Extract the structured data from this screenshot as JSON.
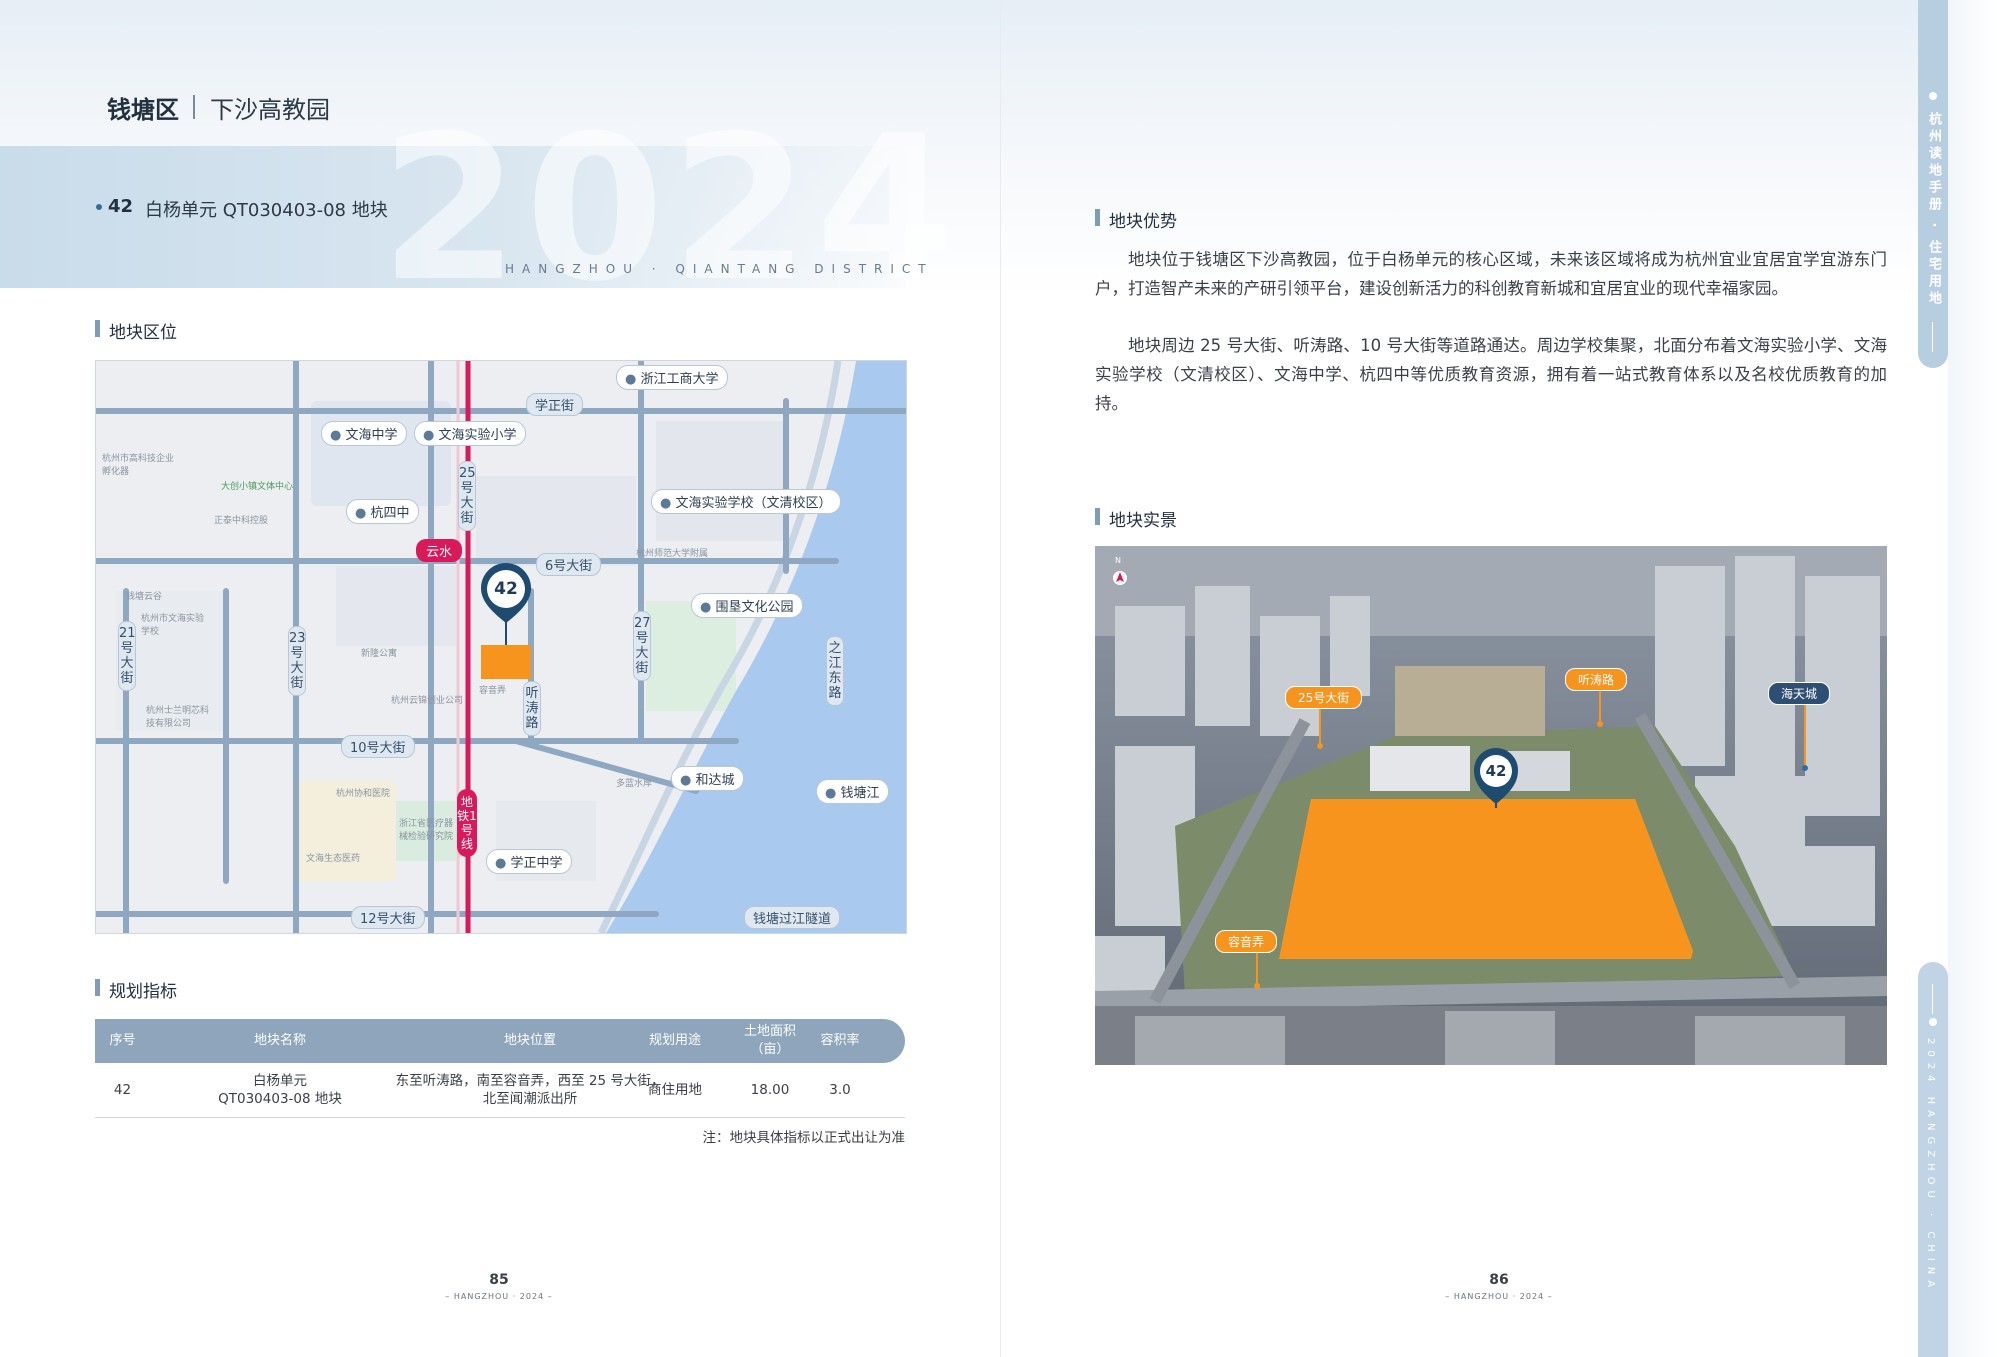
{
  "left_page": {
    "district": "钱塘区",
    "sub_district": "下沙高教园",
    "big_year": "2024",
    "district_en": "HANGZHOU · QIANTANG DISTRICT",
    "plot_number": "42",
    "plot_name": "白杨单元 QT030403-08 地块",
    "location_title": "地块区位",
    "plan_title": "规划指标",
    "page_number": "85",
    "page_footer": "– HANGZHOU · 2024 –"
  },
  "map": {
    "marker": "42",
    "road_labels": [
      "学正街",
      "6号大街",
      "10号大街",
      "12号大街",
      "21号大街",
      "23号大街",
      "25号大街",
      "27号大街",
      "听涛路",
      "之江东路",
      "钱塘过江隧道"
    ],
    "pois": [
      {
        "type": "学",
        "name": "浙江工商大学"
      },
      {
        "type": "学",
        "name": "文海中学"
      },
      {
        "type": "学",
        "name": "文海实验小学"
      },
      {
        "type": "学",
        "name": "文海实验学校（文清校区）"
      },
      {
        "type": "学",
        "name": "杭四中"
      },
      {
        "type": "学",
        "name": "学正中学"
      },
      {
        "type": "文",
        "name": "围垦文化公园"
      },
      {
        "type": "商",
        "name": "和达城"
      },
      {
        "type": "景",
        "name": "钱塘江"
      }
    ],
    "metro_station": "云水",
    "metro_line": "地铁1号线",
    "minor_labels": [
      "杭州市高科技企业孵化器",
      "大创小镇文体中心",
      "正泰中科控股",
      "杭州云锦创业公司",
      "新隆公寓",
      "杭州师范大学附属",
      "多蓝水岸",
      "容音弄",
      "钱塘云谷",
      "杭州市文海实验学校",
      "浙江省医疗器械检验研究院",
      "杭州协和医院",
      "文海生态医药",
      "杭州士兰明芯科技有限公司"
    ]
  },
  "plan_table": {
    "headers": [
      "序号",
      "地块名称",
      "地块位置",
      "规划用途",
      "土地面积\n（亩）",
      "容积率"
    ],
    "rows": [
      [
        "42",
        "白杨单元\nQT030403-08 地块",
        "东至听涛路，南至容音弄，西至 25 号大街，\n北至闻潮派出所",
        "商住用地",
        "18.00",
        "3.0"
      ]
    ],
    "note": "注：地块具体指标以正式出让为准"
  },
  "right_page": {
    "advantage_title": "地块优势",
    "para1": "地块位于钱塘区下沙高教园，位于白杨单元的核心区域，未来该区域将成为杭州宜业宜居宜学宜游东门户，打造智产未来的产研引领平台，建设创新活力的科创教育新城和宜居宜业的现代幸福家园。",
    "para2": "地块周边 25 号大街、听涛路、10 号大街等道路通达。周边学校集聚，北面分布着文海实验小学、文海实验学校（文清校区）、文海中学、杭四中等优质教育资源，拥有着一站式教育体系以及名校优质教育的加持。",
    "photo_title": "地块实景",
    "photo_labels": [
      "25号大街",
      "听涛路",
      "海天城",
      "容音弄"
    ],
    "photo_marker": "42",
    "compass": "N",
    "page_number": "86",
    "page_footer": "– HANGZHOU · 2024 –"
  },
  "side_tabs": {
    "top_text": "杭州读地手册 · 住宅用地",
    "bottom_text": "2024 HANGZHOU · CHINA"
  },
  "colors": {
    "plot_orange": "#f7941d",
    "metro_red": "#d8195a",
    "road_blue": "#8fa8c2",
    "header_blue": "#8ea5bb",
    "accent": "#7f9bb6"
  }
}
